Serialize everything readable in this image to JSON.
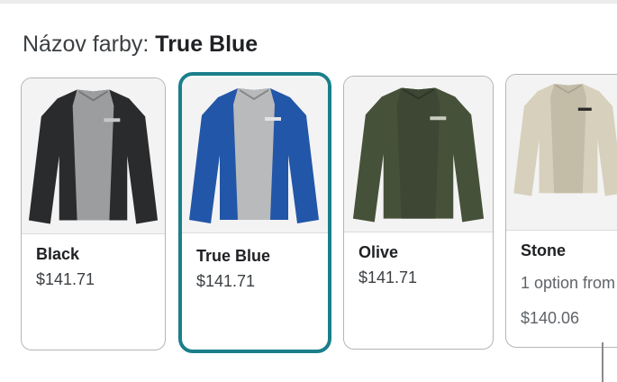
{
  "header": {
    "label": "Názov farby:",
    "selected_value": "True Blue"
  },
  "swatches": [
    {
      "name": "Black",
      "price": "$141.71",
      "selected": false,
      "color": "#2a2b2d",
      "icon": "jacket-image"
    },
    {
      "name": "True Blue",
      "price": "$141.71",
      "selected": true,
      "color": "#2256a8",
      "icon": "jacket-image"
    },
    {
      "name": "Olive",
      "price": "$141.71",
      "selected": false,
      "color": "#46513a",
      "icon": "jacket-image"
    },
    {
      "name": "Stone",
      "note": "1 option from",
      "price": "$140.06",
      "selected": false,
      "color": "#d6d0bc",
      "icon": "jacket-image"
    }
  ],
  "colors": {
    "selected_border": "#1a7f8a",
    "card_border": "#b5b5b5"
  }
}
